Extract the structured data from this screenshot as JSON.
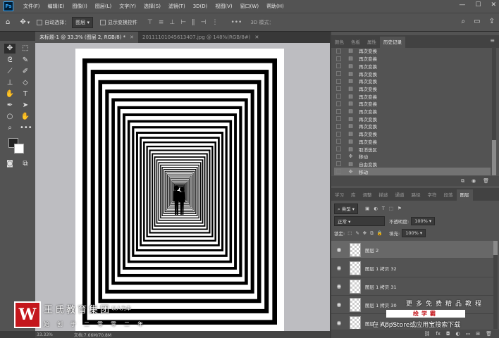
{
  "app": {
    "logo_text": "Ps"
  },
  "menu": [
    "文件(F)",
    "编辑(E)",
    "图像(I)",
    "图层(L)",
    "文字(Y)",
    "选择(S)",
    "滤镜(T)",
    "3D(D)",
    "视图(V)",
    "窗口(W)",
    "帮助(H)"
  ],
  "options": {
    "auto_select_label": "自动选择：",
    "auto_select_value": "图层",
    "transform_label": "显示变换控件",
    "mode_3d_label": "3D 模式："
  },
  "tabs": [
    {
      "label": "未标题-1 @ 33.3% (图层 2, RGB/8) *",
      "active": true
    },
    {
      "label": "20111101045613407.jpg @ 148%(RGB/8#)",
      "active": false
    }
  ],
  "status": {
    "zoom": "33.33%",
    "doc": "文档:7.66M/70.8M"
  },
  "history_panel": {
    "tabs": [
      "颜色",
      "色板",
      "属性",
      "历史记录"
    ],
    "active_tab": "历史记录",
    "items": [
      {
        "label": "再次变换",
        "icon": "document-icon"
      },
      {
        "label": "再次变换",
        "icon": "document-icon"
      },
      {
        "label": "再次变换",
        "icon": "document-icon"
      },
      {
        "label": "再次变换",
        "icon": "document-icon"
      },
      {
        "label": "再次变换",
        "icon": "document-icon"
      },
      {
        "label": "再次变换",
        "icon": "document-icon"
      },
      {
        "label": "再次变换",
        "icon": "document-icon"
      },
      {
        "label": "再次变换",
        "icon": "document-icon"
      },
      {
        "label": "再次变换",
        "icon": "document-icon"
      },
      {
        "label": "再次变换",
        "icon": "document-icon"
      },
      {
        "label": "再次变换",
        "icon": "document-icon"
      },
      {
        "label": "再次变换",
        "icon": "document-icon"
      },
      {
        "label": "再次变换",
        "icon": "document-icon"
      },
      {
        "label": "取消选区",
        "icon": "document-icon"
      },
      {
        "label": "移动",
        "icon": "move-icon"
      },
      {
        "label": "自由变换",
        "icon": "document-icon"
      },
      {
        "label": "移动",
        "icon": "move-icon",
        "selected": true
      }
    ]
  },
  "layers_panel": {
    "tabs": [
      "学习",
      "库",
      "调整",
      "描述",
      "通道",
      "路径",
      "字符",
      "段落",
      "图层"
    ],
    "active_tab": "图层",
    "filter_label": "类型",
    "blend_mode": "正常",
    "opacity_label": "不透明度:",
    "opacity_value": "100%",
    "lock_label": "锁定:",
    "fill_label": "填充:",
    "fill_value": "100%",
    "layers": [
      {
        "name": "图层 2",
        "selected": true
      },
      {
        "name": "图层 1 拷贝 32"
      },
      {
        "name": "图层 1 拷贝 31"
      },
      {
        "name": "图层 1 拷贝 30"
      },
      {
        "name": "图层 1 拷贝 29"
      }
    ]
  },
  "watermark": {
    "logo_letter": "W",
    "title": "王氏教育集团",
    "slogan": "以人为本",
    "subtitle": "始创于二零零二年",
    "right_line1": "更多免费精品教程",
    "badge": "绘学霸",
    "right_line3": "在 AppStore或应用宝搜索下载"
  }
}
